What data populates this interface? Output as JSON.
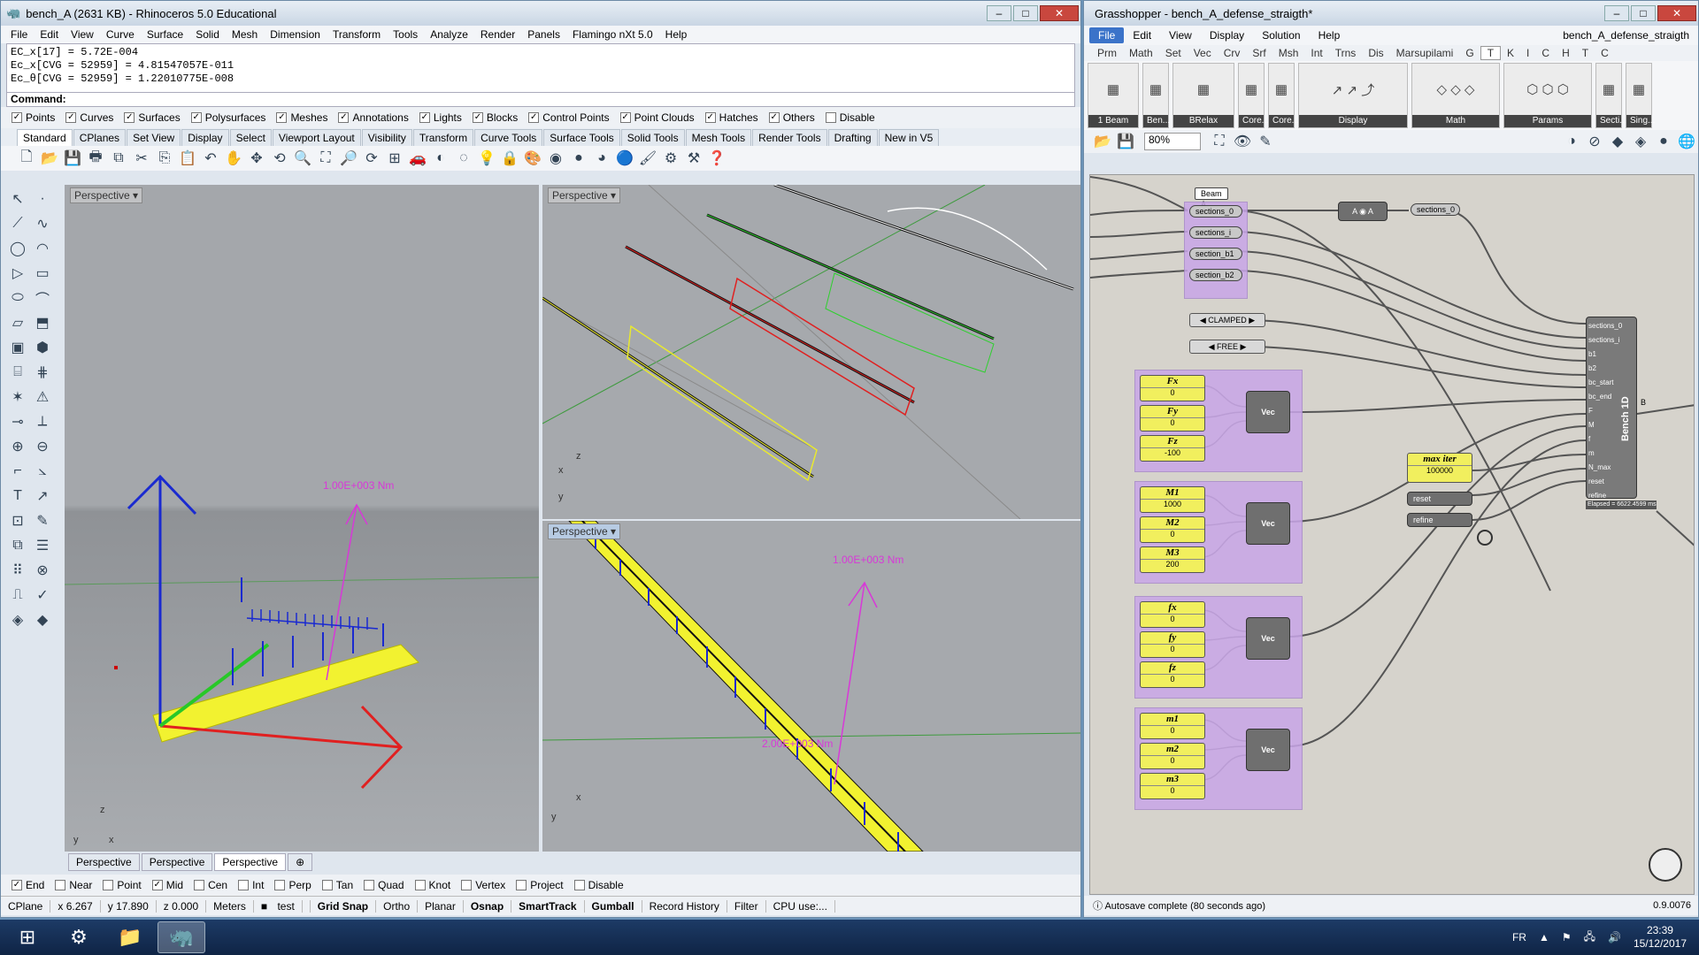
{
  "rhino": {
    "title": "bench_A (2631 KB) - Rhinoceros 5.0 Educational",
    "menu": [
      "File",
      "Edit",
      "View",
      "Curve",
      "Surface",
      "Solid",
      "Mesh",
      "Dimension",
      "Transform",
      "Tools",
      "Analyze",
      "Render",
      "Panels",
      "Flamingo nXt 5.0",
      "Help"
    ],
    "history": [
      "EC_x[17] = 5.72E-004",
      "Ec_x[CVG = 52959] = 4.81547057E-011",
      "Ec_θ[CVG = 52959] = 1.22010775E-008"
    ],
    "command_label": "Command:",
    "filters": [
      {
        "label": "Points",
        "checked": true
      },
      {
        "label": "Curves",
        "checked": true
      },
      {
        "label": "Surfaces",
        "checked": true
      },
      {
        "label": "Polysurfaces",
        "checked": true
      },
      {
        "label": "Meshes",
        "checked": true
      },
      {
        "label": "Annotations",
        "checked": true
      },
      {
        "label": "Lights",
        "checked": true
      },
      {
        "label": "Blocks",
        "checked": true
      },
      {
        "label": "Control Points",
        "checked": true
      },
      {
        "label": "Point Clouds",
        "checked": true
      },
      {
        "label": "Hatches",
        "checked": true
      },
      {
        "label": "Others",
        "checked": true
      },
      {
        "label": "Disable",
        "checked": false
      }
    ],
    "tabs": [
      "Standard",
      "CPlanes",
      "Set View",
      "Display",
      "Select",
      "Viewport Layout",
      "Visibility",
      "Transform",
      "Curve Tools",
      "Surface Tools",
      "Solid Tools",
      "Mesh Tools",
      "Render Tools",
      "Drafting",
      "New in V5"
    ],
    "active_tab": "Standard",
    "viewports": {
      "tl": {
        "title": "Perspective",
        "label": "1.00E+003 Nm"
      },
      "tr": {
        "title": "Perspective"
      },
      "br": {
        "title": "Perspective",
        "label": "1.00E+003 Nm",
        "label2": "2.00E+003 Nm"
      },
      "bl": {
        "title": "Perspective"
      }
    },
    "vp_tabs": [
      "Perspective",
      "Perspective",
      "Perspective"
    ],
    "vp_tab_active": 2,
    "osnaps": [
      {
        "label": "End",
        "checked": true
      },
      {
        "label": "Near",
        "checked": false
      },
      {
        "label": "Point",
        "checked": false
      },
      {
        "label": "Mid",
        "checked": true
      },
      {
        "label": "Cen",
        "checked": false
      },
      {
        "label": "Int",
        "checked": false
      },
      {
        "label": "Perp",
        "checked": false
      },
      {
        "label": "Tan",
        "checked": false
      },
      {
        "label": "Quad",
        "checked": false
      },
      {
        "label": "Knot",
        "checked": false
      },
      {
        "label": "Vertex",
        "checked": false
      },
      {
        "label": "Project",
        "checked": false
      },
      {
        "label": "Disable",
        "checked": false
      }
    ],
    "status": {
      "cplane": "CPlane",
      "x": "x 6.267",
      "y": "y 17.890",
      "z": "z 0.000",
      "units": "Meters",
      "layer": "test",
      "toggles": [
        "Grid Snap",
        "Ortho",
        "Planar",
        "Osnap",
        "SmartTrack",
        "Gumball",
        "Record History",
        "Filter",
        "CPU use:..."
      ]
    }
  },
  "gh": {
    "title": "Grasshopper - bench_A_defense_straigth*",
    "menu": [
      "File",
      "Edit",
      "View",
      "Display",
      "Solution",
      "Help"
    ],
    "doc_name": "bench_A_defense_straigth",
    "tabs": [
      "Prm",
      "Math",
      "Set",
      "Vec",
      "Crv",
      "Srf",
      "Msh",
      "Int",
      "Trns",
      "Dis",
      "Marsupilami",
      "G",
      "T",
      "K",
      "I",
      "C",
      "H",
      "T",
      "C"
    ],
    "active_tab_index": 12,
    "ribbon_groups": [
      "1 Beam",
      "Ben...",
      "BRelax",
      "Core...",
      "Core...",
      "Display",
      "Math",
      "Params",
      "Secti...",
      "Sing..."
    ],
    "zoom": "80%",
    "status": "Autosave complete (80 seconds ago)",
    "version": "0.9.0076",
    "canvas": {
      "beam_label": "Beam A",
      "sections": [
        "sections_0",
        "sections_i",
        "section_b1",
        "section_b2"
      ],
      "sections_out": "sections_0",
      "bc_start": "CLAMPED",
      "bc_end": "FREE",
      "F": [
        {
          "name": "Fx",
          "val": "0"
        },
        {
          "name": "Fy",
          "val": "0"
        },
        {
          "name": "Fz",
          "val": "-100"
        }
      ],
      "M": [
        {
          "name": "M1",
          "val": "1000"
        },
        {
          "name": "M2",
          "val": "0"
        },
        {
          "name": "M3",
          "val": "200"
        }
      ],
      "f": [
        {
          "name": "fx",
          "val": "0"
        },
        {
          "name": "fy",
          "val": "0"
        },
        {
          "name": "fz",
          "val": "0"
        }
      ],
      "m": [
        {
          "name": "m1",
          "val": "0"
        },
        {
          "name": "m2",
          "val": "0"
        },
        {
          "name": "m3",
          "val": "0"
        }
      ],
      "vec": "Vec",
      "max_iter": {
        "name": "max iter",
        "val": "100000"
      },
      "reset": "reset",
      "refine": "refine",
      "bench": {
        "name": "Bench 1D",
        "inputs": [
          "sections_0",
          "sections_i",
          "b1",
          "b2",
          "bc_start",
          "bc_end",
          "F",
          "M",
          "f",
          "m",
          "N_max",
          "reset",
          "refine"
        ],
        "elapsed": "Elapsed = 6622.4599 ms",
        "out": "B"
      }
    }
  },
  "taskbar": {
    "lang": "FR",
    "time": "23:39",
    "date": "15/12/2017"
  }
}
